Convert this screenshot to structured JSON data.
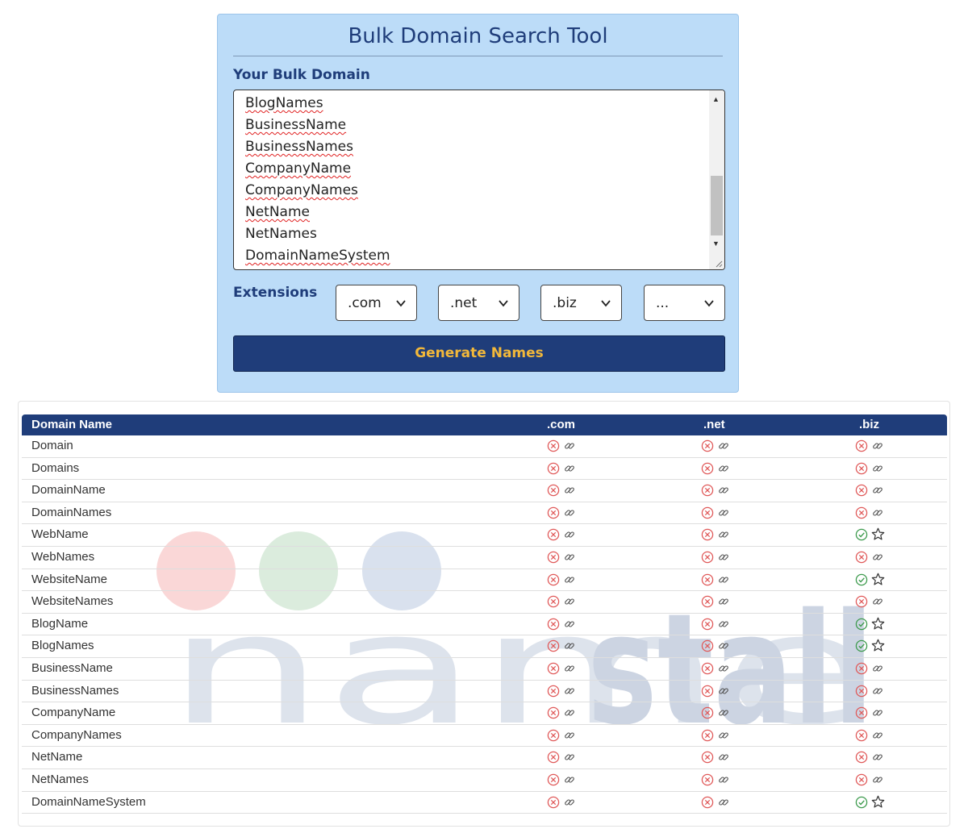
{
  "form": {
    "title": "Bulk Domain Search Tool",
    "bulk_label": "Your Bulk Domain",
    "textarea_lines": [
      {
        "text": "BlogNames",
        "misspelled": true
      },
      {
        "text": "BusinessName",
        "misspelled": true
      },
      {
        "text": "BusinessNames",
        "misspelled": true
      },
      {
        "text": "CompanyName",
        "misspelled": true
      },
      {
        "text": "CompanyNames",
        "misspelled": true
      },
      {
        "text": "NetName",
        "misspelled": true
      },
      {
        "text": "NetNames",
        "misspelled": false
      },
      {
        "text": "DomainNameSystem",
        "misspelled": true
      }
    ],
    "extensions_label": "Extensions",
    "extension_selects": [
      ".com",
      ".net",
      ".biz",
      "..."
    ],
    "generate_label": "Generate Names"
  },
  "table": {
    "headers": {
      "name": "Domain Name",
      "com": ".com",
      "net": ".net",
      "biz": ".biz"
    },
    "rows": [
      {
        "name": "Domain",
        "com": "taken",
        "net": "taken",
        "biz": "taken"
      },
      {
        "name": "Domains",
        "com": "taken",
        "net": "taken",
        "biz": "taken"
      },
      {
        "name": "DomainName",
        "com": "taken",
        "net": "taken",
        "biz": "taken"
      },
      {
        "name": "DomainNames",
        "com": "taken",
        "net": "taken",
        "biz": "taken"
      },
      {
        "name": "WebName",
        "com": "taken",
        "net": "taken",
        "biz": "available"
      },
      {
        "name": "WebNames",
        "com": "taken",
        "net": "taken",
        "biz": "taken"
      },
      {
        "name": "WebsiteName",
        "com": "taken",
        "net": "taken",
        "biz": "available"
      },
      {
        "name": "WebsiteNames",
        "com": "taken",
        "net": "taken",
        "biz": "taken"
      },
      {
        "name": "BlogName",
        "com": "taken",
        "net": "taken",
        "biz": "available"
      },
      {
        "name": "BlogNames",
        "com": "taken",
        "net": "taken",
        "biz": "available"
      },
      {
        "name": "BusinessName",
        "com": "taken",
        "net": "taken",
        "biz": "taken"
      },
      {
        "name": "BusinessNames",
        "com": "taken",
        "net": "taken",
        "biz": "taken"
      },
      {
        "name": "CompanyName",
        "com": "taken",
        "net": "taken",
        "biz": "taken"
      },
      {
        "name": "CompanyNames",
        "com": "taken",
        "net": "taken",
        "biz": "taken"
      },
      {
        "name": "NetName",
        "com": "taken",
        "net": "taken",
        "biz": "taken"
      },
      {
        "name": "NetNames",
        "com": "taken",
        "net": "taken",
        "biz": "taken"
      },
      {
        "name": "DomainNameSystem",
        "com": "taken",
        "net": "taken",
        "biz": "available"
      }
    ]
  },
  "watermark": {
    "text": "namestall"
  },
  "colors": {
    "brand_navy": "#1f3d7a",
    "button_text": "#f2b83a",
    "panel_bg": "#bcdcf8",
    "taken_red": "#e05a5a",
    "available_green": "#3e9b4e"
  },
  "icons": {
    "taken": "x-circle-icon",
    "available": "check-circle-icon",
    "whois": "link-icon",
    "favorite": "star-icon"
  }
}
